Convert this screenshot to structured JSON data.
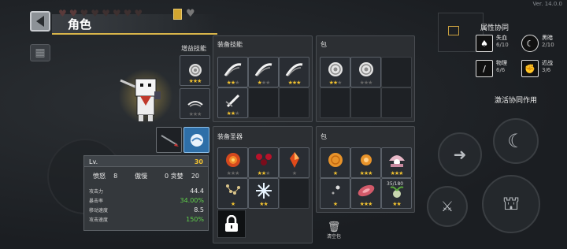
{
  "version": "Ver. 14.0.0",
  "header": {
    "title": "角色"
  },
  "gain_skill": {
    "label": "增益技能",
    "slots": [
      {
        "icon": "spiral-orb-icon",
        "stars": 3,
        "max": 3
      },
      {
        "icon": "wind-swirl-icon",
        "stars": 0,
        "max": 3
      }
    ]
  },
  "equip_skill": {
    "label": "装备技能",
    "slots": [
      {
        "icon": "slash-arc-icon",
        "stars": 2,
        "max": 3
      },
      {
        "icon": "slash-arc-icon",
        "stars": 1,
        "max": 3
      },
      {
        "icon": "slash-arc-icon",
        "stars": 3,
        "max": 3
      },
      {
        "icon": "slash-stab-icon",
        "stars": 2,
        "max": 3
      },
      {
        "icon": "",
        "stars": null
      },
      {
        "icon": "",
        "stars": null
      }
    ]
  },
  "bag_top": {
    "label": "包",
    "slots": [
      {
        "icon": "spiral-orb-icon",
        "stars": 2,
        "max": 3
      },
      {
        "icon": "spiral-orb-icon",
        "stars": 0,
        "max": 3
      },
      {
        "icon": "",
        "stars": null
      },
      {
        "icon": "",
        "stars": null
      },
      {
        "icon": "",
        "stars": null
      },
      {
        "icon": "",
        "stars": null
      }
    ]
  },
  "equip_relic": {
    "label": "装备圣器",
    "slots": [
      {
        "icon": "fire-orb-icon",
        "stars": 0,
        "max": 3
      },
      {
        "icon": "red-chain-icon",
        "stars": 2,
        "max": 3
      },
      {
        "icon": "red-crystal-icon",
        "stars": 0,
        "max": 1
      },
      {
        "icon": "bead-string-icon",
        "stars": 1,
        "max": 1
      },
      {
        "icon": "snowflake-icon",
        "stars": 2,
        "max": 2
      },
      {
        "icon": "",
        "stars": null
      }
    ]
  },
  "bag_bottom": {
    "label": "包",
    "counter": "35/180",
    "slots": [
      {
        "icon": "orange-coin-icon",
        "stars": 1,
        "max": 1
      },
      {
        "icon": "orange-gem-icon",
        "stars": 3,
        "max": 3
      },
      {
        "icon": "pearl-shell-icon",
        "stars": 3,
        "max": 3
      },
      {
        "icon": "dots-icon",
        "stars": 1,
        "max": 1
      },
      {
        "icon": "meat-slice-icon",
        "stars": 3,
        "max": 3
      },
      {
        "icon": "sprout-icon",
        "stars": 2,
        "max": 2
      }
    ]
  },
  "stats": {
    "level_label": "Lv.",
    "level_value": "30",
    "traits": [
      {
        "label": "愤怒",
        "value": "8"
      },
      {
        "label": "傲慢",
        "value": "0"
      },
      {
        "label": "贪婪",
        "value": "20"
      }
    ],
    "rows": [
      {
        "label": "攻击力",
        "value": "44.4",
        "color": "#e8e8e8"
      },
      {
        "label": "暴击率",
        "value": "34.00%",
        "color": "#5fd14a"
      },
      {
        "label": "移动速度",
        "value": "8.5",
        "color": "#e8e8e8"
      },
      {
        "label": "攻击速度",
        "value": "150%",
        "color": "#5fd14a"
      }
    ]
  },
  "synergy": {
    "title": "属性协同",
    "items": [
      {
        "name": "失血",
        "count": "6/10",
        "icon": "blood-drop-icon"
      },
      {
        "name": "黑暗",
        "count": "2/10",
        "icon": "dark-moon-icon"
      },
      {
        "name": "物理",
        "count": "6/6",
        "icon": "sword-icon"
      },
      {
        "name": "近战",
        "count": "3/6",
        "icon": "fist-icon"
      }
    ],
    "activate_label": "激活协同作用"
  },
  "trash_label": "清空包",
  "colors": {
    "accent": "#d9b54a",
    "star": "#f2c230",
    "green": "#5fd14a"
  }
}
